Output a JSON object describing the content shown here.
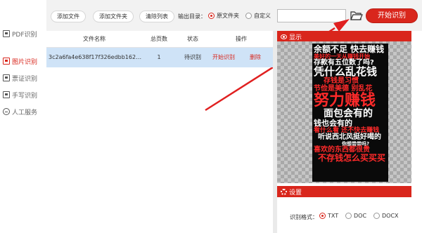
{
  "sidebar": {
    "items": [
      {
        "label": "PDF识别",
        "icon": "pdf-icon"
      },
      {
        "label": "图片识别",
        "icon": "image-icon"
      },
      {
        "label": "票证识别",
        "icon": "ticket-icon"
      },
      {
        "label": "手写识别",
        "icon": "handwriting-icon"
      },
      {
        "label": "人工服务",
        "icon": "service-icon"
      }
    ],
    "active_index": 1
  },
  "toolbar": {
    "add_file": "添加文件",
    "add_folder": "添加文件夹",
    "clear_list": "清除列表",
    "output_label": "输出目录：",
    "radio_original": "原文件夹",
    "radio_custom": "自定义",
    "selected_output": "原文件夹",
    "path_value": "",
    "start_label": "开始识别"
  },
  "table": {
    "headers": [
      "文件名称",
      "总页数",
      "状态",
      "操作"
    ],
    "rows": [
      {
        "file": "3c2a6fa4e638f17f326edbb162c852b...",
        "pages": "1",
        "status": "待识别",
        "action_start": "开始识别",
        "action_delete": "删除"
      }
    ]
  },
  "preview": {
    "title": "显示",
    "poster_lines": [
      {
        "text": "余额不足 快去赚钱",
        "color": "white"
      },
      {
        "text": "美好的一天从赚钱开始",
        "color": "red"
      },
      {
        "text": "存款有五位数了吗?",
        "color": "white"
      },
      {
        "text": "凭什么乱花钱",
        "color": "white"
      },
      {
        "text": "存钱是习惯",
        "color": "red"
      },
      {
        "text": "节俭是美德  别乱花",
        "color": "red"
      },
      {
        "text": "努力赚钱",
        "color": "red"
      },
      {
        "text": "面包会有的",
        "color": "white"
      },
      {
        "text": "钱也会有的",
        "color": "white"
      },
      {
        "text": "看什么看 还不快去赚钱",
        "color": "red"
      },
      {
        "text": "听说西北风挺好喝的",
        "color": "white"
      },
      {
        "text": "你想尝尝吗?",
        "color": "white"
      },
      {
        "text": "喜欢的东西都很贵",
        "color": "red"
      },
      {
        "text": "不存钱怎么买买买",
        "color": "red"
      }
    ]
  },
  "settings": {
    "title": "设置",
    "format_label": "识别格式：",
    "formats": [
      "TXT",
      "DOC",
      "DOCX"
    ],
    "selected_format": "TXT"
  },
  "colors": {
    "accent": "#d9261c",
    "row_selected": "#cfe3f7",
    "toolbar_bg": "#f2f2f2"
  }
}
